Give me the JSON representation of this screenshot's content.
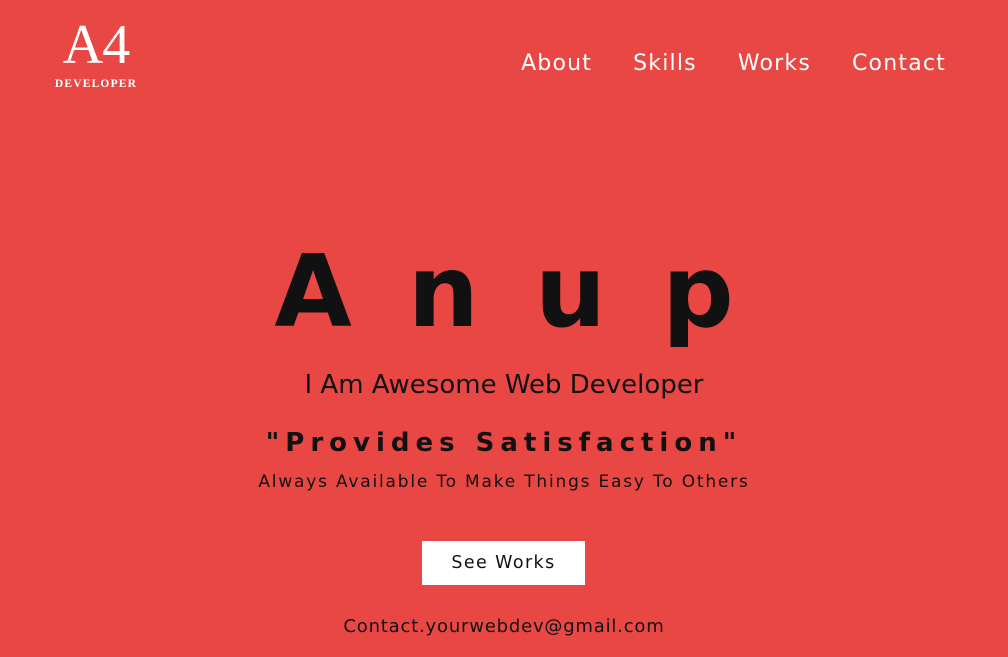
{
  "logo": {
    "mark": "A4",
    "subtitle": "DEVELOPER"
  },
  "nav": {
    "items": [
      {
        "label": "About"
      },
      {
        "label": "Skills"
      },
      {
        "label": "Works"
      },
      {
        "label": "Contact"
      }
    ]
  },
  "hero": {
    "name": "Anup",
    "role": "I Am Awesome Web Developer",
    "tagline": "\"Provides Satisfaction\"",
    "subtitle": "Always Available To Make Things Easy To Others",
    "cta_label": "See Works",
    "contact": "Contact.yourwebdev@gmail.com"
  },
  "colors": {
    "background": "#e94744",
    "text_dark": "#111111",
    "text_light": "#ffffff",
    "button_bg": "#ffffff"
  }
}
